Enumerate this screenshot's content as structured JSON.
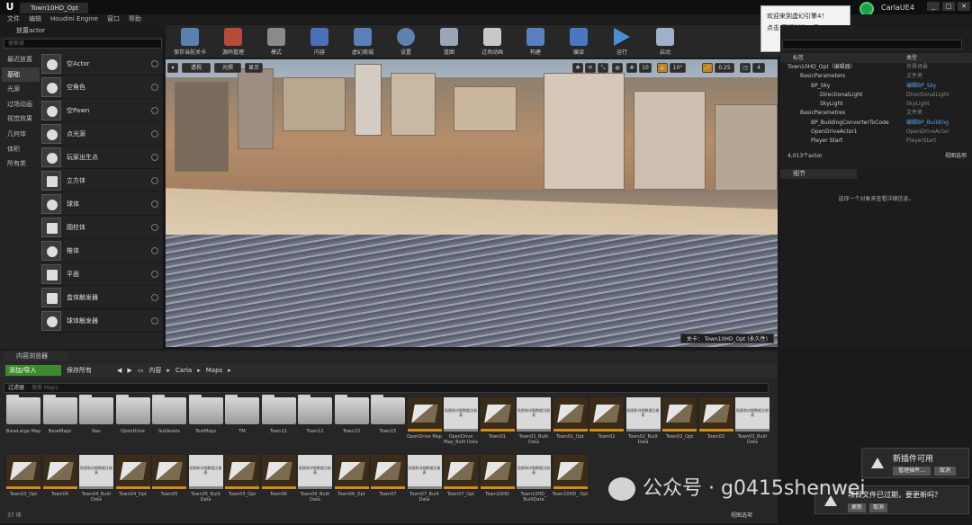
{
  "window": {
    "tab": "Town10HD_Opt",
    "badge": "CarlaUE4",
    "controls": [
      "_",
      "□",
      "✕"
    ]
  },
  "menu": [
    "文件",
    "编辑",
    "Houdini Engine",
    "窗口",
    "帮助"
  ],
  "left_panel": {
    "title": "放置actor",
    "search_placeholder": "搜索类",
    "categories": [
      "最近放置",
      "基础",
      "光源",
      "过场动画",
      "视觉效果",
      "几何体",
      "体积",
      "所有类"
    ],
    "selected_category": "基础",
    "items": [
      "空Actor",
      "空角色",
      "空Pawn",
      "点光源",
      "玩家出生点",
      "立方体",
      "球体",
      "圆柱体",
      "椎体",
      "平面",
      "盒体触发器",
      "球体触发器"
    ]
  },
  "toolbar": [
    {
      "label": "保存当前关卡",
      "icon": "save-icon"
    },
    {
      "label": "源码管理",
      "icon": "source-control-icon"
    },
    {
      "label": "模式",
      "icon": "modes-icon"
    },
    {
      "label": "内容",
      "icon": "content-icon"
    },
    {
      "label": "虚幻商城",
      "icon": "marketplace-icon"
    },
    {
      "label": "设置",
      "icon": "settings-icon"
    },
    {
      "label": "蓝图",
      "icon": "blueprint-icon"
    },
    {
      "label": "过场动画",
      "icon": "cinematics-icon"
    },
    {
      "label": "构建",
      "icon": "build-icon"
    },
    {
      "label": "编译",
      "icon": "compile-icon"
    },
    {
      "label": "运行",
      "icon": "play-icon"
    },
    {
      "label": "启动",
      "icon": "launch-icon"
    }
  ],
  "viewport": {
    "view_mode_1": "透视",
    "view_mode_2": "光照",
    "show": "显示",
    "grid_snap": "10",
    "rot_snap": "10°",
    "scale_snap": "0.25",
    "cam_speed": "4",
    "level_label": "关卡： Town10HD_Opt (永久性)"
  },
  "toast": {
    "line1": "欢迎来到虚幻引擎4！",
    "line2": "点击 图标浏览工具。"
  },
  "outliner": {
    "col_label": "标签",
    "col_type": "类型",
    "rows": [
      {
        "label": "Town10HD_Opt（编辑器）",
        "type": "世界场景"
      },
      {
        "label": "BasicParameters",
        "type": "文件夹"
      },
      {
        "label": "BP_Sky",
        "type": "编辑BP_Sky",
        "link": true
      },
      {
        "label": "DirectionalLight",
        "type": "DirectionalLight"
      },
      {
        "label": "SkyLight",
        "type": "SkyLight"
      },
      {
        "label": "BasicParametres",
        "type": "文件夹"
      },
      {
        "label": "BP_BuildingConverterToCode",
        "type": "编辑BP_Building",
        "link": true
      },
      {
        "label": "OpenDriveActor1",
        "type": "OpenDriveActor"
      },
      {
        "label": "Player Start",
        "type": "PlayerStart"
      }
    ],
    "count": "4,013个actor",
    "view_options": "视图选项"
  },
  "details": {
    "tab": "细节",
    "empty_msg": "选择一个对象来查看详细信息。"
  },
  "content_browser": {
    "tab": "内容浏览器",
    "add": "添加/导入",
    "save_all": "保存所有",
    "path": [
      "内容",
      "Carla",
      "Maps"
    ],
    "filter": "过滤器",
    "search_placeholder": "搜索 Maps",
    "assets": [
      {
        "name": "BaseLarge Map",
        "kind": "folder"
      },
      {
        "name": "BaseMaps",
        "kind": "folder"
      },
      {
        "name": "Nav",
        "kind": "folder"
      },
      {
        "name": "OpenDrive",
        "kind": "folder"
      },
      {
        "name": "Sublevels",
        "kind": "folder"
      },
      {
        "name": "TestMaps",
        "kind": "folder"
      },
      {
        "name": "TM",
        "kind": "folder"
      },
      {
        "name": "Town11",
        "kind": "folder"
      },
      {
        "name": "Town12",
        "kind": "folder"
      },
      {
        "name": "Town13",
        "kind": "folder"
      },
      {
        "name": "Town15",
        "kind": "folder"
      },
      {
        "name": "OpenDrive Map",
        "kind": "map"
      },
      {
        "name": "OpenDrive Map_Built Data",
        "kind": "data"
      },
      {
        "name": "Town01",
        "kind": "map"
      },
      {
        "name": "Town01_Built Data",
        "kind": "data"
      },
      {
        "name": "Town01_Opt",
        "kind": "map"
      },
      {
        "name": "Town02",
        "kind": "map"
      },
      {
        "name": "Town02_Built Data",
        "kind": "data"
      },
      {
        "name": "Town02_Opt",
        "kind": "map"
      },
      {
        "name": "Town03",
        "kind": "map"
      },
      {
        "name": "Town03_Built Data",
        "kind": "data"
      },
      {
        "name": "Town03_Opt",
        "kind": "map"
      },
      {
        "name": "Town04",
        "kind": "map"
      },
      {
        "name": "Town04_Built Data",
        "kind": "data"
      },
      {
        "name": "Town04_Opt",
        "kind": "map"
      },
      {
        "name": "Town05",
        "kind": "map"
      },
      {
        "name": "Town05_Built Data",
        "kind": "data"
      },
      {
        "name": "Town05_Opt",
        "kind": "map"
      },
      {
        "name": "Town06",
        "kind": "map"
      },
      {
        "name": "Town06_Built Data",
        "kind": "data"
      },
      {
        "name": "Town06_Opt",
        "kind": "map"
      },
      {
        "name": "Town07",
        "kind": "map"
      },
      {
        "name": "Town07_Built Data",
        "kind": "data"
      },
      {
        "name": "Town07_Opt",
        "kind": "map"
      },
      {
        "name": "Town10HD",
        "kind": "map"
      },
      {
        "name": "Town10HD_ BuiltData",
        "kind": "data"
      },
      {
        "name": "Town10HD_ Opt",
        "kind": "map"
      }
    ],
    "data_thumb_text": "贴图和详细数据注册表",
    "count": "37 项",
    "view_options": "视图选项"
  },
  "plugin_toast": {
    "title": "新插件可用",
    "manage": "管理插件...",
    "dismiss": "取消"
  },
  "reload_toast": {
    "title": "项目文件已过期，要更新吗？",
    "yes": "更新",
    "no": "取消"
  },
  "watermark": "公众号 · g0415shenwei"
}
